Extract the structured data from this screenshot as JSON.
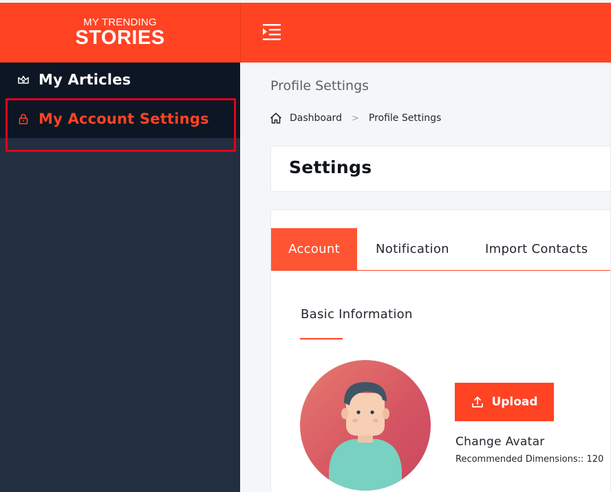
{
  "brand": {
    "line1": "MY TRENDING",
    "line2": "STORIES",
    "color": "#ff4323"
  },
  "header": {
    "menu_icon": "indent-menu-icon"
  },
  "sidebar": {
    "items": [
      {
        "label": "My Articles",
        "icon": "crown-icon",
        "active": false
      },
      {
        "label": "My Account Settings",
        "icon": "lock-icon",
        "active": true
      }
    ]
  },
  "page": {
    "heading": "Profile Settings",
    "breadcrumb": {
      "home_icon": "home-icon",
      "items": [
        "Dashboard",
        "Profile Settings"
      ]
    }
  },
  "settings": {
    "title": "Settings",
    "tabs": [
      {
        "label": "Account",
        "active": true
      },
      {
        "label": "Notification",
        "active": false
      },
      {
        "label": "Import Contacts",
        "active": false
      }
    ],
    "basic_info": {
      "title": "Basic Information",
      "avatar_icon": "user-avatar",
      "upload_label": "Upload",
      "upload_icon": "upload-icon",
      "change_avatar_label": "Change Avatar",
      "hint": "Recommended Dimensions:: 120"
    }
  },
  "colors": {
    "accent": "#ff4323",
    "sidebar_bg": "#232f40",
    "sidebar_top": "#0d1624",
    "highlight_border": "#e8001c"
  }
}
